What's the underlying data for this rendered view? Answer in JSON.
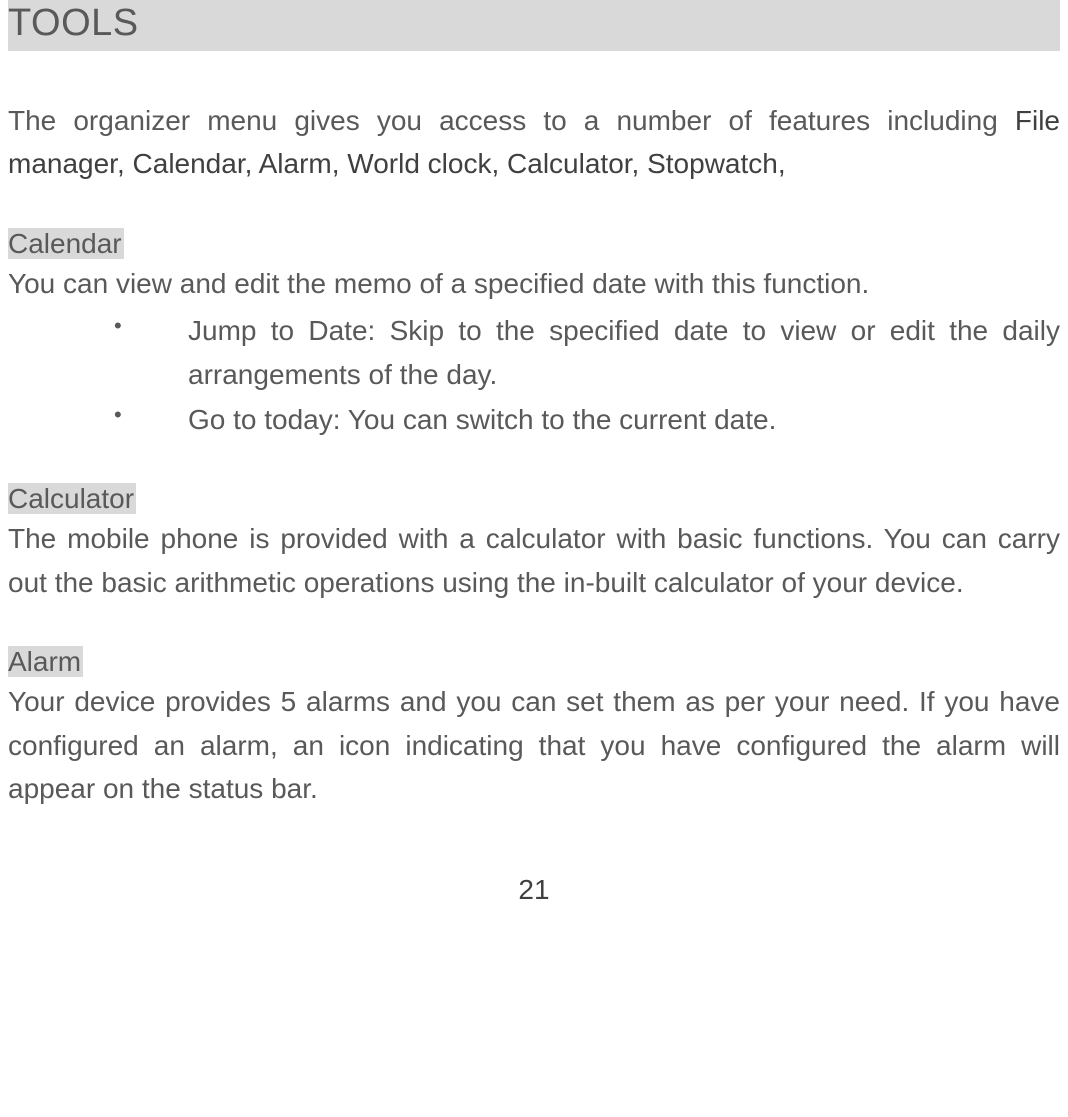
{
  "heading": "TOOLS",
  "intro": {
    "prefix": "The organizer menu gives you access to a number of features including ",
    "boldList": "File manager, Calendar, Alarm, World clock, Calculator, Stopwatch,"
  },
  "sections": [
    {
      "title": "Calendar",
      "body": "You can view and edit the memo of a specified date with this function.",
      "bullets": [
        "Jump to Date: Skip to the specified date to view or edit the daily arrangements of the day.",
        "Go to today: You can switch to the current date."
      ]
    },
    {
      "title": "Calculator",
      "body": "The mobile phone is provided with a calculator with basic functions. You can carry out the basic arithmetic operations using the in-built calculator of your device.",
      "bullets": []
    },
    {
      "title": "Alarm",
      "body": "Your device provides 5 alarms and you can set them as per your need. If you have configured an alarm, an icon indicating that you have configured the alarm will appear on the status bar.",
      "bullets": []
    }
  ],
  "pageNumber": "21"
}
